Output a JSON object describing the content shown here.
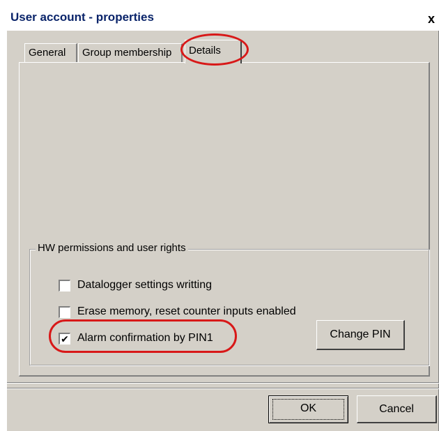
{
  "window": {
    "title": "User account - properties",
    "close_glyph": "x"
  },
  "tabs": [
    {
      "label": "General",
      "active": false
    },
    {
      "label": "Group membership",
      "active": false
    },
    {
      "label": "Details",
      "active": true
    }
  ],
  "hw_permissions": {
    "legend": "HW permissions and user rights",
    "items": [
      {
        "label": "Datalogger settings writting",
        "checked": false
      },
      {
        "label": "Erase memory, reset counter inputs enabled",
        "checked": false
      },
      {
        "label": "Alarm confirmation by PIN1",
        "checked": true
      }
    ],
    "change_pin_label": "Change PIN"
  },
  "footer": {
    "ok_label": "OK",
    "cancel_label": "Cancel"
  },
  "annotations": {
    "highlight_color": "#d81818",
    "highlighted": [
      "Details",
      "Alarm confirmation by PIN1"
    ]
  },
  "icons": {
    "close": "close-icon",
    "check": "checkmark-icon"
  },
  "colors": {
    "title_text": "#0a246a",
    "dialog_bg": "#d4d0c8"
  }
}
